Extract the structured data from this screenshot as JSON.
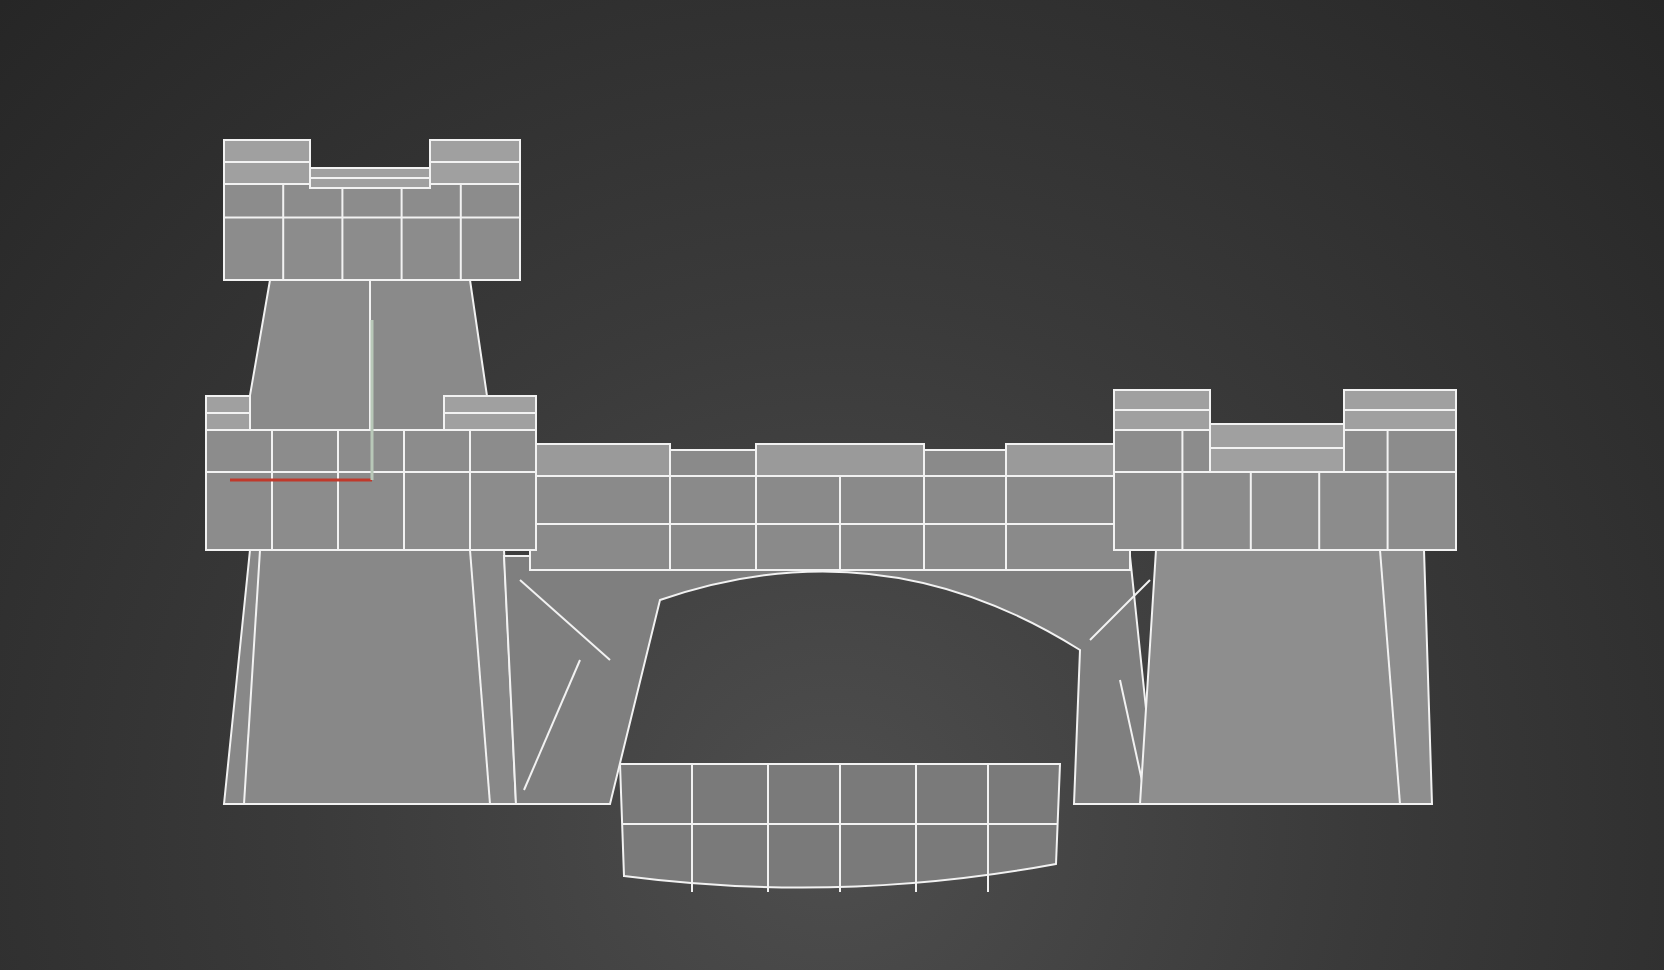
{
  "viewport": {
    "show_gizmo": true
  }
}
